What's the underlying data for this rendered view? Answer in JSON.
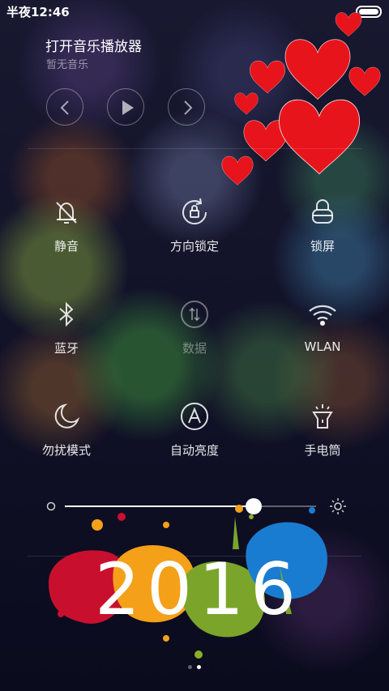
{
  "status_bar": {
    "time": "半夜12:46"
  },
  "music": {
    "title": "打开音乐播放器",
    "subtitle": "暂无音乐"
  },
  "toggles": [
    {
      "label": "静音",
      "icon": "bell-muted-icon",
      "active": true
    },
    {
      "label": "方向锁定",
      "icon": "rotation-lock-icon",
      "active": true
    },
    {
      "label": "锁屏",
      "icon": "lock-icon",
      "active": true
    },
    {
      "label": "蓝牙",
      "icon": "bluetooth-icon",
      "active": true
    },
    {
      "label": "数据",
      "icon": "mobile-data-icon",
      "active": false
    },
    {
      "label": "WLAN",
      "icon": "wifi-icon",
      "active": true
    },
    {
      "label": "勿扰模式",
      "icon": "moon-icon",
      "active": true
    },
    {
      "label": "自动亮度",
      "icon": "auto-brightness-icon",
      "active": true
    },
    {
      "label": "手电筒",
      "icon": "flashlight-icon",
      "active": true
    }
  ],
  "brightness": {
    "level": 0.75
  },
  "decoration": {
    "year_text": "2016"
  },
  "pager": {
    "count": 2,
    "current": 1
  }
}
